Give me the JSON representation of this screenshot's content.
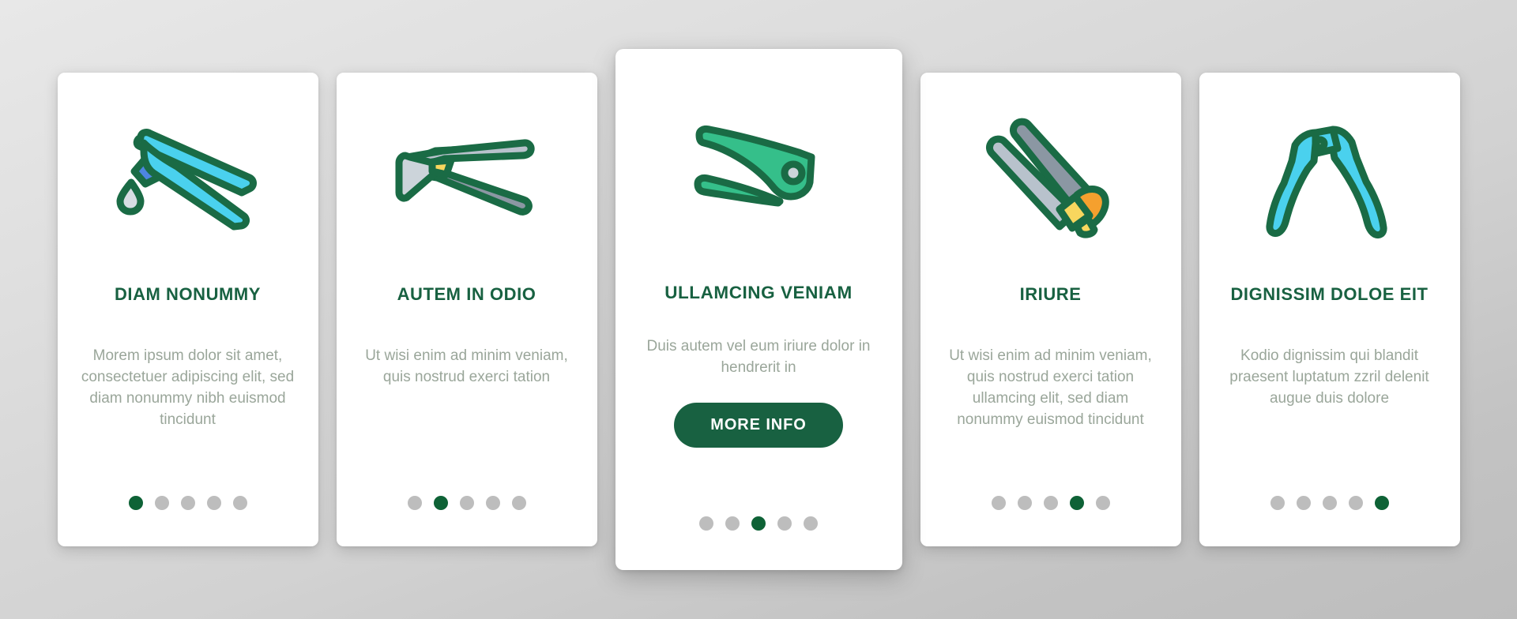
{
  "theme": {
    "background_gradient_from": "#e8e8e8",
    "background_gradient_to": "#bdbdbd",
    "card_background": "#ffffff",
    "title_color": "#186141",
    "body_text_color": "#9aa69a",
    "accent_green": "#186141",
    "dot_active_color": "#0e6236",
    "dot_inactive_color": "#bdbdbd",
    "button_text_color": "#ffffff",
    "icon_outline_color": "#1a6b45",
    "icon_cyan": "#4ad1ee",
    "icon_blue": "#4d85e0",
    "icon_green": "#35bf8a",
    "icon_gray": "#b8c2cc",
    "icon_gray_dark": "#8b97a3",
    "icon_orange": "#f5a02e",
    "icon_yellow": "#f8d65e"
  },
  "cards": [
    {
      "id": "card-1",
      "icon_name": "pliers-with-drop-icon",
      "title": "DIAM NONUMMY",
      "body": "Morem ipsum dolor sit amet, consectetuer adipiscing elit, sed diam nonummy nibh euismod tincidunt",
      "featured": false,
      "dots": {
        "count": 5,
        "active_index": 0
      }
    },
    {
      "id": "card-2",
      "icon_name": "pincers-tool-icon",
      "title": "AUTEM IN ODIO",
      "body": "Ut wisi enim ad minim veniam, quis nostrud exerci tation",
      "featured": false,
      "dots": {
        "count": 5,
        "active_index": 1
      }
    },
    {
      "id": "card-3",
      "icon_name": "pruning-shears-icon",
      "title": "ULLAMCING VENIAM",
      "body": "Duis autem vel eum iriure dolor in hendrerit in",
      "featured": true,
      "cta_label": "MORE INFO",
      "dots": {
        "count": 5,
        "active_index": 2
      }
    },
    {
      "id": "card-4",
      "icon_name": "tweezers-icon",
      "title": "IRIURE",
      "body": "Ut wisi enim ad minim veniam, quis nostrud exerci tation ullamcing elit, sed diam nonummy euismod tincidunt",
      "featured": false,
      "dots": {
        "count": 5,
        "active_index": 3
      }
    },
    {
      "id": "card-5",
      "icon_name": "nippers-icon",
      "title": "DIGNISSIM DOLOE EIT",
      "body": "Kodio dignissim qui blandit praesent luptatum zzril delenit augue duis dolore",
      "featured": false,
      "dots": {
        "count": 5,
        "active_index": 4
      }
    }
  ]
}
